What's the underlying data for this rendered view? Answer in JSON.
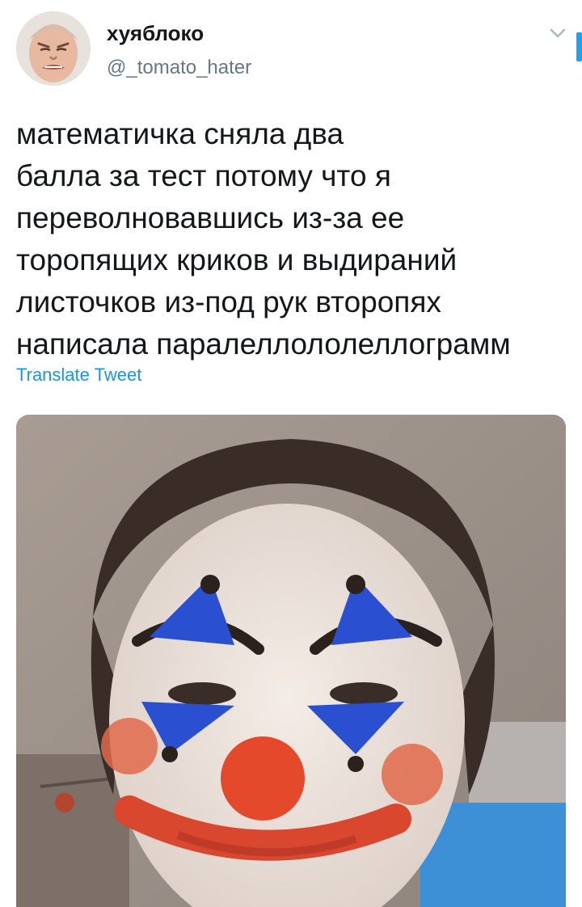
{
  "tweet": {
    "display_name": "хуяблоко",
    "handle": "@_tomato_hater",
    "text_lines": [
      "математичка сняла два",
      "балла за тест потому что я",
      "переволновавшись из-за ее",
      "торопящих криков и выдираний",
      "листочков из-под рук второпях",
      "написала паралеллололеллограмм"
    ],
    "translate_label": "Translate Tweet"
  },
  "icons": {
    "menu": "chevron-down-icon"
  },
  "colors": {
    "link": "#1b95e0",
    "secondary_text": "#657786",
    "primary_text": "#14171a",
    "scroll_accent": "#1da1f2"
  }
}
